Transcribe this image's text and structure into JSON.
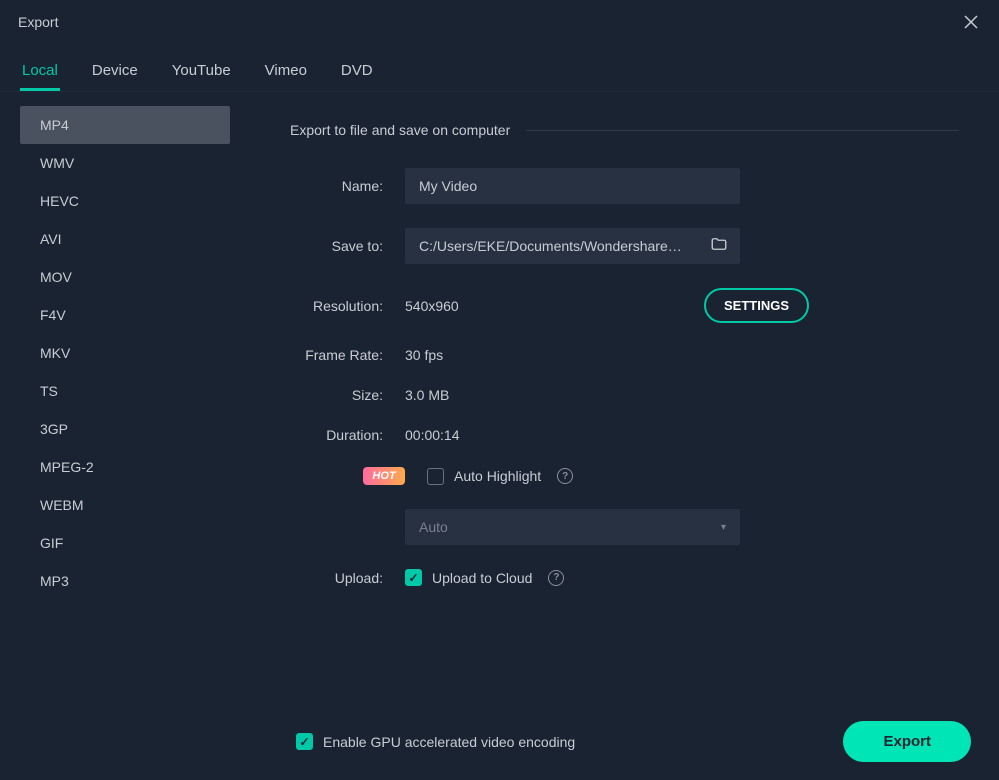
{
  "window": {
    "title": "Export"
  },
  "tabs": [
    {
      "label": "Local",
      "active": true
    },
    {
      "label": "Device",
      "active": false
    },
    {
      "label": "YouTube",
      "active": false
    },
    {
      "label": "Vimeo",
      "active": false
    },
    {
      "label": "DVD",
      "active": false
    }
  ],
  "formats": [
    {
      "label": "MP4",
      "active": true
    },
    {
      "label": "WMV",
      "active": false
    },
    {
      "label": "HEVC",
      "active": false
    },
    {
      "label": "AVI",
      "active": false
    },
    {
      "label": "MOV",
      "active": false
    },
    {
      "label": "F4V",
      "active": false
    },
    {
      "label": "MKV",
      "active": false
    },
    {
      "label": "TS",
      "active": false
    },
    {
      "label": "3GP",
      "active": false
    },
    {
      "label": "MPEG-2",
      "active": false
    },
    {
      "label": "WEBM",
      "active": false
    },
    {
      "label": "GIF",
      "active": false
    },
    {
      "label": "MP3",
      "active": false
    }
  ],
  "section_header": "Export to file and save on computer",
  "form": {
    "name_label": "Name:",
    "name_value": "My Video",
    "save_to_label": "Save to:",
    "save_to_value": "C:/Users/EKE/Documents/Wondershare/W",
    "resolution_label": "Resolution:",
    "resolution_value": "540x960",
    "settings_label": "SETTINGS",
    "framerate_label": "Frame Rate:",
    "framerate_value": "30 fps",
    "size_label": "Size:",
    "size_value": "3.0 MB",
    "duration_label": "Duration:",
    "duration_value": "00:00:14",
    "hot_badge": "HOT",
    "auto_highlight_label": "Auto Highlight",
    "auto_highlight_checked": false,
    "highlight_select": "Auto",
    "upload_label": "Upload:",
    "upload_cloud_label": "Upload to Cloud",
    "upload_cloud_checked": true
  },
  "footer": {
    "gpu_label": "Enable GPU accelerated video encoding",
    "gpu_checked": true,
    "export_label": "Export"
  }
}
